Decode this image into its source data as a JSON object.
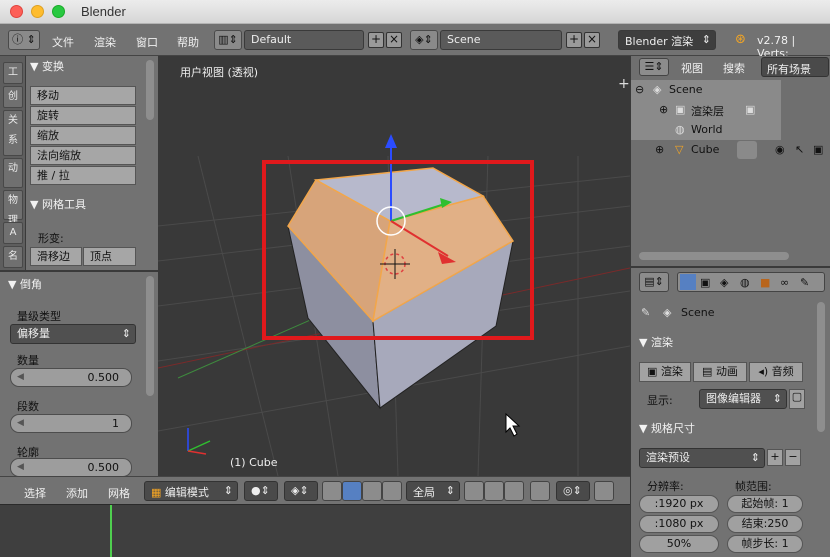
{
  "window": {
    "title": "Blender"
  },
  "header": {
    "menus": [
      "文件",
      "渲染",
      "窗口",
      "帮助"
    ],
    "screen_layout": "Default",
    "scene_name": "Scene",
    "render_engine": "Blender 渲染",
    "version": "v2.78 | Verts:"
  },
  "toolshelf": {
    "transform": {
      "title": "变换",
      "buttons": [
        "移动",
        "旋转",
        "缩放",
        "法向缩放",
        "推 / 拉"
      ]
    },
    "mesh_tools": {
      "title": "网格工具",
      "deform_label": "形变:",
      "buttons": [
        "滑移边",
        "顶点"
      ]
    },
    "tab_labels": [
      "工",
      "创",
      "关系",
      "动",
      "物理",
      "A",
      "名"
    ]
  },
  "bevel": {
    "title": "倒角",
    "amount_type_label": "量级类型",
    "amount_type_value": "偏移量",
    "amount_label": "数量",
    "amount_value": "0.500",
    "segments_label": "段数",
    "segments_value": "1",
    "profile_label": "轮廓",
    "profile_value": "0.500"
  },
  "viewport": {
    "title": "用户视图 (透视)",
    "object_label": "(1) Cube",
    "colors": {
      "face": "#9a9ab0",
      "selected_face": "#d9a77a",
      "edge_sel": "#f0a030",
      "highlight_box": "#e0191c"
    }
  },
  "view_footer": {
    "menus": [
      "选择",
      "添加",
      "网格"
    ],
    "mode": "编辑模式",
    "pivot_orientation": "全局"
  },
  "outliner": {
    "view_menu": "视图",
    "search_menu": "搜索",
    "filter": "所有场景",
    "items": [
      {
        "label": "Scene",
        "selected": true
      },
      {
        "label": "渲染层",
        "selected": true
      },
      {
        "label": "World",
        "selected": true
      },
      {
        "label": "Cube",
        "selected": false
      }
    ]
  },
  "properties": {
    "context": "Scene",
    "render_panel": {
      "title": "渲染",
      "buttons": [
        "渲染",
        "动画",
        "音频"
      ],
      "display_label": "显示:",
      "display_value": "图像编辑器"
    },
    "dimensions_panel": {
      "title": "规格尺寸",
      "preset": "渲染预设",
      "resolution_label": "分辨率:",
      "res_x": ":1920 px",
      "res_y": ":1080 px",
      "res_percent": "50%",
      "frame_range_label": "帧范围:",
      "frame_start": "起始帧: 1",
      "frame_end": "结束:250",
      "frame_step": "帧步长: 1"
    }
  }
}
